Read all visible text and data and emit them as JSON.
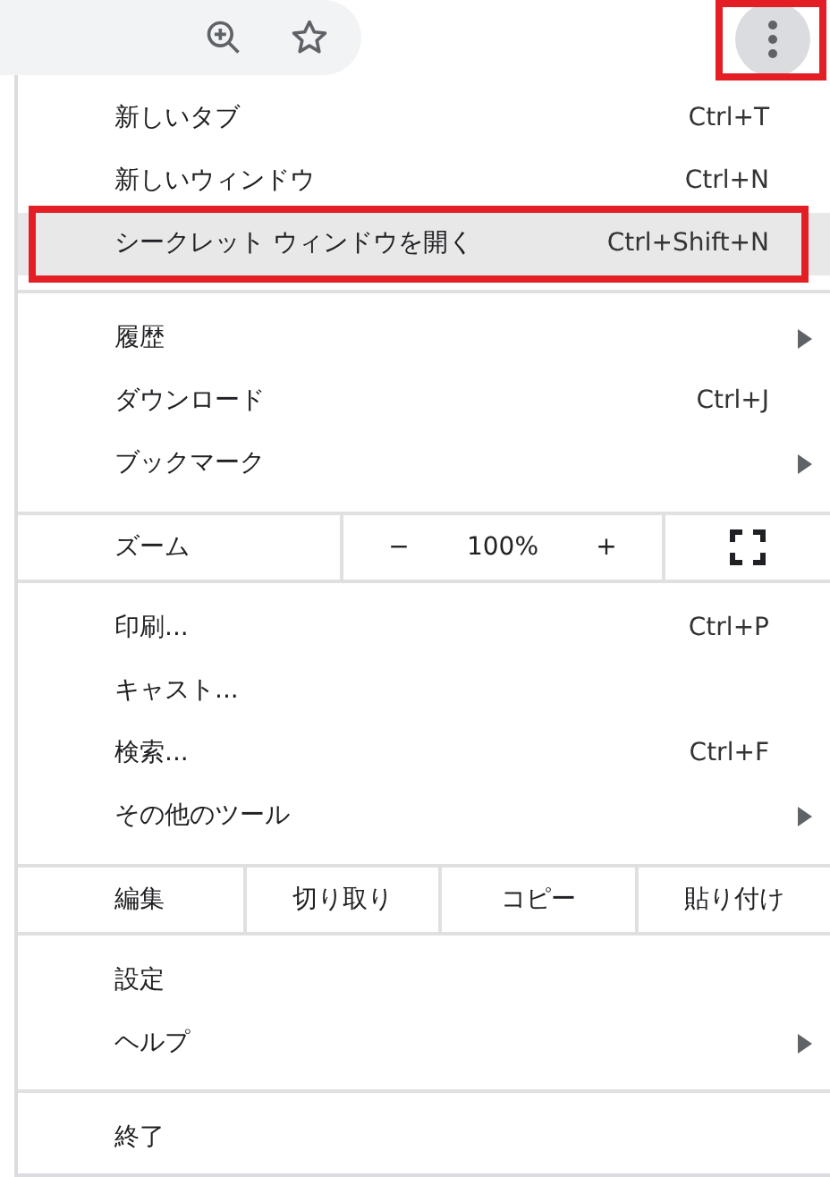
{
  "toolbar": {
    "menu_button": {
      "annotated": true
    }
  },
  "menu": [
    {
      "kind": "item",
      "label": "新しいタブ",
      "shortcut": "Ctrl+T",
      "selected": false,
      "annotated": false,
      "submenu": false
    },
    {
      "kind": "item",
      "label": "新しいウィンドウ",
      "shortcut": "Ctrl+N",
      "selected": false,
      "annotated": false,
      "submenu": false
    },
    {
      "kind": "item",
      "label": "シークレット ウィンドウを開く",
      "shortcut": "Ctrl+Shift+N",
      "selected": true,
      "annotated": true,
      "submenu": false
    },
    {
      "kind": "divider"
    },
    {
      "kind": "item",
      "label": "履歴",
      "selected": false,
      "annotated": false,
      "submenu": true
    },
    {
      "kind": "item",
      "label": "ダウンロード",
      "shortcut": "Ctrl+J",
      "selected": false,
      "annotated": false,
      "submenu": false
    },
    {
      "kind": "item",
      "label": "ブックマーク",
      "selected": false,
      "annotated": false,
      "submenu": true
    },
    {
      "kind": "divider"
    },
    {
      "kind": "zoom",
      "label": "ズーム",
      "minus": "−",
      "value": "100%",
      "plus": "+"
    },
    {
      "kind": "divider"
    },
    {
      "kind": "item",
      "label": "印刷...",
      "shortcut": "Ctrl+P",
      "selected": false,
      "annotated": false,
      "submenu": false
    },
    {
      "kind": "item",
      "label": "キャスト...",
      "selected": false,
      "annotated": false,
      "submenu": false
    },
    {
      "kind": "item",
      "label": "検索...",
      "shortcut": "Ctrl+F",
      "selected": false,
      "annotated": false,
      "submenu": false
    },
    {
      "kind": "item",
      "label": "その他のツール",
      "selected": false,
      "annotated": false,
      "submenu": true
    },
    {
      "kind": "divider"
    },
    {
      "kind": "edit",
      "label": "編集",
      "actions": [
        "切り取り",
        "コピー",
        "貼り付け"
      ]
    },
    {
      "kind": "divider"
    },
    {
      "kind": "item",
      "label": "設定",
      "selected": false,
      "annotated": false,
      "submenu": false
    },
    {
      "kind": "item",
      "label": "ヘルプ",
      "selected": false,
      "annotated": false,
      "submenu": true
    },
    {
      "kind": "divider"
    },
    {
      "kind": "item",
      "label": "終了",
      "selected": false,
      "annotated": false,
      "submenu": false
    }
  ]
}
